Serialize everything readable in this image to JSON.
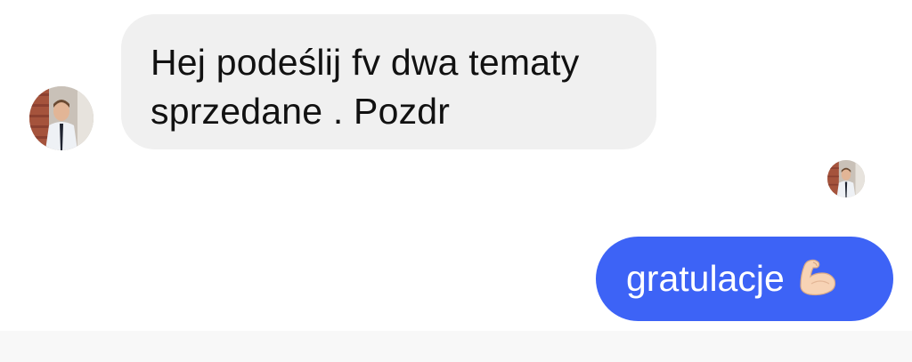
{
  "messages": [
    {
      "direction": "incoming",
      "lines": [
        "Hej podeślij fv dwa tematy",
        "sprzedane . Pozdr"
      ]
    },
    {
      "direction": "outgoing",
      "text": "gratulacje",
      "emoji": "flexed-biceps-icon"
    }
  ],
  "colors": {
    "incoming_bubble": "#f0f0f0",
    "outgoing_bubble": "#3d63f6",
    "incoming_text": "#111111",
    "outgoing_text": "#ffffff",
    "bottom_bar": "#f8f8f8"
  }
}
